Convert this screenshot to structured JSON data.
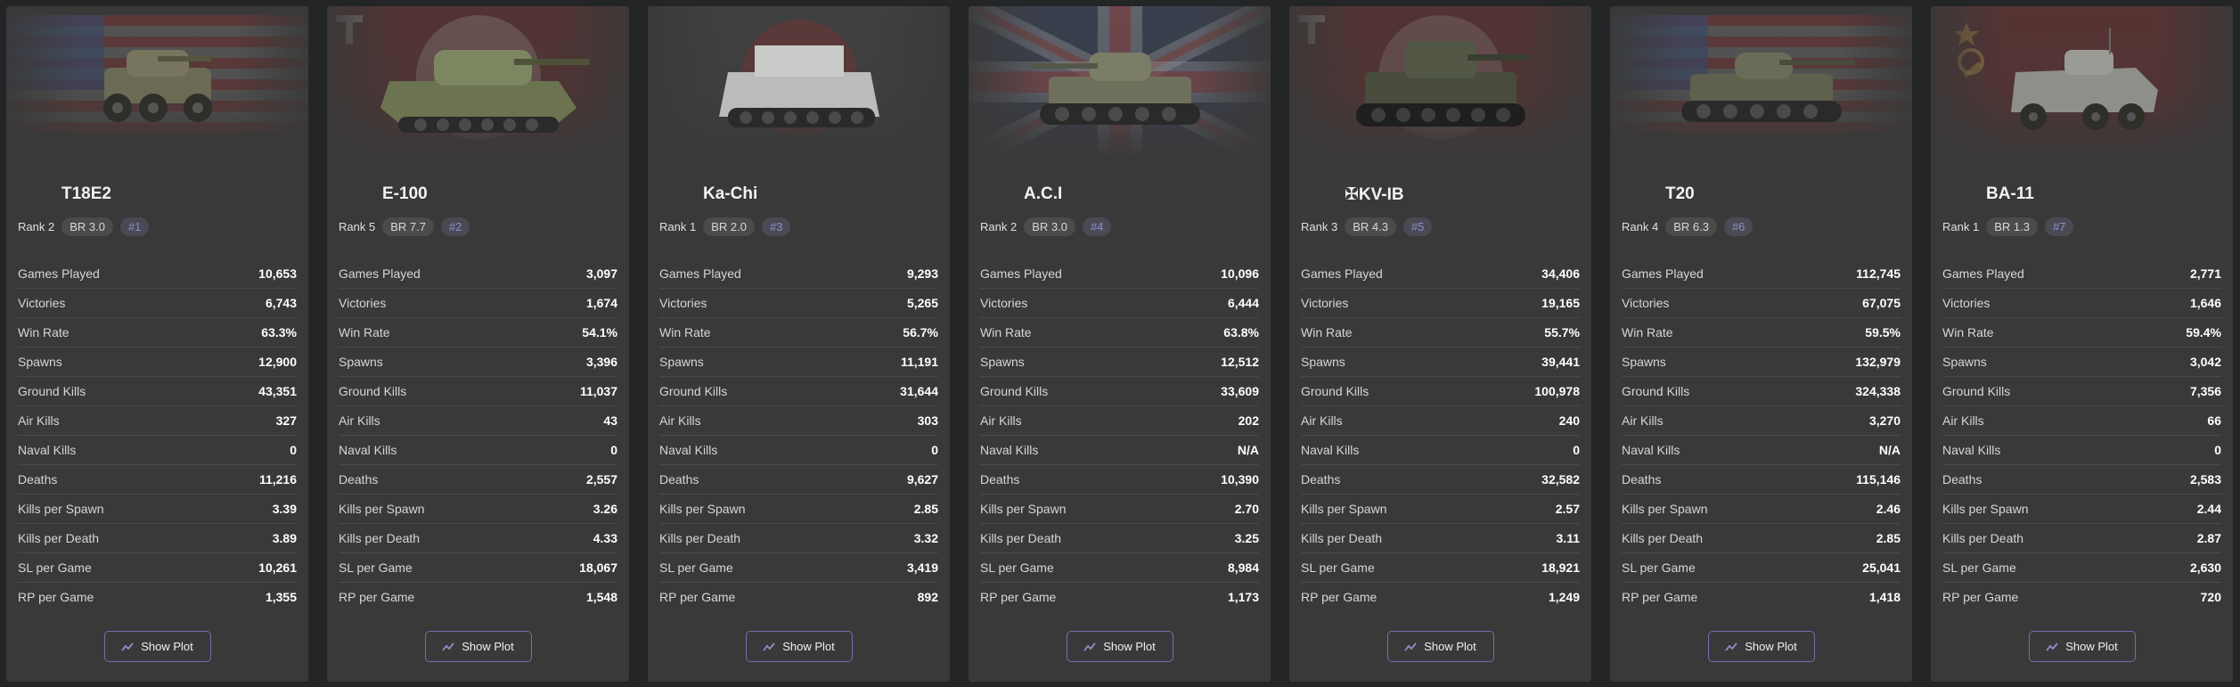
{
  "vehicles": [
    {
      "name": "T18E2",
      "rank": "Rank 2",
      "br": "BR 3.0",
      "index": "#1",
      "flag": "usa",
      "stats": [
        {
          "label": "Games Played",
          "value": "10,653"
        },
        {
          "label": "Victories",
          "value": "6,743"
        },
        {
          "label": "Win Rate",
          "value": "63.3%"
        },
        {
          "label": "Spawns",
          "value": "12,900"
        },
        {
          "label": "Ground Kills",
          "value": "43,351"
        },
        {
          "label": "Air Kills",
          "value": "327"
        },
        {
          "label": "Naval Kills",
          "value": "0"
        },
        {
          "label": "Deaths",
          "value": "11,216"
        },
        {
          "label": "Kills per Spawn",
          "value": "3.39"
        },
        {
          "label": "Kills per Death",
          "value": "3.89"
        },
        {
          "label": "SL per Game",
          "value": "10,261"
        },
        {
          "label": "RP per Game",
          "value": "1,355"
        }
      ]
    },
    {
      "name": "E-100",
      "rank": "Rank 5",
      "br": "BR 7.7",
      "index": "#2",
      "flag": "germany",
      "stats": [
        {
          "label": "Games Played",
          "value": "3,097"
        },
        {
          "label": "Victories",
          "value": "1,674"
        },
        {
          "label": "Win Rate",
          "value": "54.1%"
        },
        {
          "label": "Spawns",
          "value": "3,396"
        },
        {
          "label": "Ground Kills",
          "value": "11,037"
        },
        {
          "label": "Air Kills",
          "value": "43"
        },
        {
          "label": "Naval Kills",
          "value": "0"
        },
        {
          "label": "Deaths",
          "value": "2,557"
        },
        {
          "label": "Kills per Spawn",
          "value": "3.26"
        },
        {
          "label": "Kills per Death",
          "value": "4.33"
        },
        {
          "label": "SL per Game",
          "value": "18,067"
        },
        {
          "label": "RP per Game",
          "value": "1,548"
        }
      ]
    },
    {
      "name": "Ka-Chi",
      "rank": "Rank 1",
      "br": "BR 2.0",
      "index": "#3",
      "flag": "japan",
      "stats": [
        {
          "label": "Games Played",
          "value": "9,293"
        },
        {
          "label": "Victories",
          "value": "5,265"
        },
        {
          "label": "Win Rate",
          "value": "56.7%"
        },
        {
          "label": "Spawns",
          "value": "11,191"
        },
        {
          "label": "Ground Kills",
          "value": "31,644"
        },
        {
          "label": "Air Kills",
          "value": "303"
        },
        {
          "label": "Naval Kills",
          "value": "0"
        },
        {
          "label": "Deaths",
          "value": "9,627"
        },
        {
          "label": "Kills per Spawn",
          "value": "2.85"
        },
        {
          "label": "Kills per Death",
          "value": "3.32"
        },
        {
          "label": "SL per Game",
          "value": "3,419"
        },
        {
          "label": "RP per Game",
          "value": "892"
        }
      ]
    },
    {
      "name": "A.C.I",
      "rank": "Rank 2",
      "br": "BR 3.0",
      "index": "#4",
      "flag": "uk",
      "stats": [
        {
          "label": "Games Played",
          "value": "10,096"
        },
        {
          "label": "Victories",
          "value": "6,444"
        },
        {
          "label": "Win Rate",
          "value": "63.8%"
        },
        {
          "label": "Spawns",
          "value": "12,512"
        },
        {
          "label": "Ground Kills",
          "value": "33,609"
        },
        {
          "label": "Air Kills",
          "value": "202"
        },
        {
          "label": "Naval Kills",
          "value": "N/A"
        },
        {
          "label": "Deaths",
          "value": "10,390"
        },
        {
          "label": "Kills per Spawn",
          "value": "2.70"
        },
        {
          "label": "Kills per Death",
          "value": "3.25"
        },
        {
          "label": "SL per Game",
          "value": "8,984"
        },
        {
          "label": "RP per Game",
          "value": "1,173"
        }
      ]
    },
    {
      "name": "✠KV-IB",
      "rank": "Rank 3",
      "br": "BR 4.3",
      "index": "#5",
      "flag": "germany",
      "stats": [
        {
          "label": "Games Played",
          "value": "34,406"
        },
        {
          "label": "Victories",
          "value": "19,165"
        },
        {
          "label": "Win Rate",
          "value": "55.7%"
        },
        {
          "label": "Spawns",
          "value": "39,441"
        },
        {
          "label": "Ground Kills",
          "value": "100,978"
        },
        {
          "label": "Air Kills",
          "value": "240"
        },
        {
          "label": "Naval Kills",
          "value": "0"
        },
        {
          "label": "Deaths",
          "value": "32,582"
        },
        {
          "label": "Kills per Spawn",
          "value": "2.57"
        },
        {
          "label": "Kills per Death",
          "value": "3.11"
        },
        {
          "label": "SL per Game",
          "value": "18,921"
        },
        {
          "label": "RP per Game",
          "value": "1,249"
        }
      ]
    },
    {
      "name": "T20",
      "rank": "Rank 4",
      "br": "BR 6.3",
      "index": "#6",
      "flag": "usa",
      "stats": [
        {
          "label": "Games Played",
          "value": "112,745"
        },
        {
          "label": "Victories",
          "value": "67,075"
        },
        {
          "label": "Win Rate",
          "value": "59.5%"
        },
        {
          "label": "Spawns",
          "value": "132,979"
        },
        {
          "label": "Ground Kills",
          "value": "324,338"
        },
        {
          "label": "Air Kills",
          "value": "3,270"
        },
        {
          "label": "Naval Kills",
          "value": "N/A"
        },
        {
          "label": "Deaths",
          "value": "115,146"
        },
        {
          "label": "Kills per Spawn",
          "value": "2.46"
        },
        {
          "label": "Kills per Death",
          "value": "2.85"
        },
        {
          "label": "SL per Game",
          "value": "25,041"
        },
        {
          "label": "RP per Game",
          "value": "1,418"
        }
      ]
    },
    {
      "name": "BA-11",
      "rank": "Rank 1",
      "br": "BR 1.3",
      "index": "#7",
      "flag": "ussr",
      "stats": [
        {
          "label": "Games Played",
          "value": "2,771"
        },
        {
          "label": "Victories",
          "value": "1,646"
        },
        {
          "label": "Win Rate",
          "value": "59.4%"
        },
        {
          "label": "Spawns",
          "value": "3,042"
        },
        {
          "label": "Ground Kills",
          "value": "7,356"
        },
        {
          "label": "Air Kills",
          "value": "66"
        },
        {
          "label": "Naval Kills",
          "value": "0"
        },
        {
          "label": "Deaths",
          "value": "2,583"
        },
        {
          "label": "Kills per Spawn",
          "value": "2.44"
        },
        {
          "label": "Kills per Death",
          "value": "2.87"
        },
        {
          "label": "SL per Game",
          "value": "2,630"
        },
        {
          "label": "RP per Game",
          "value": "720"
        }
      ]
    }
  ],
  "plot_button_label": "Show Plot",
  "plot_icon": "line-chart-icon",
  "colors": {
    "background": "#242526",
    "card": "#393939",
    "button_border": "#6f6fb0",
    "index_badge_text": "#8c8fc9"
  }
}
